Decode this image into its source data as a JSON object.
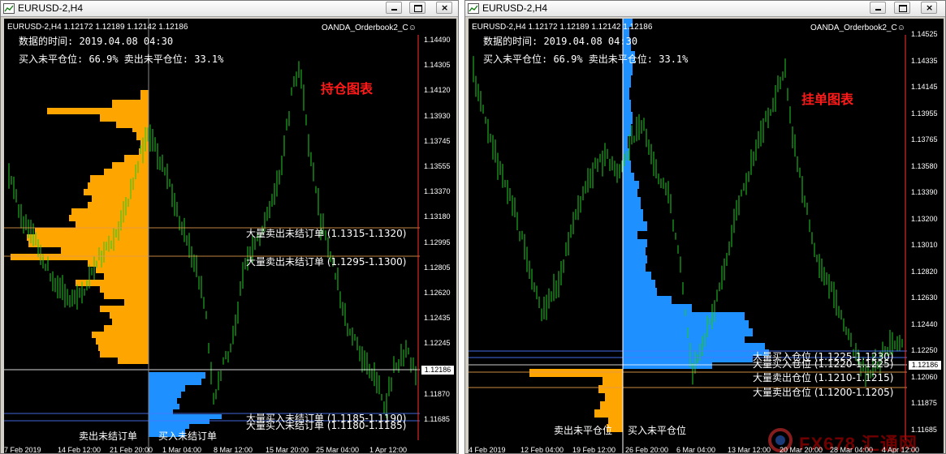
{
  "windows": [
    {
      "title": "EURUSD-2,H4",
      "chart": {
        "symbol_line": "EURUSD-2,H4   1.12172 1.12189 1.12142 1.12186",
        "indicator_name": "OANDA_Orderbook2_C",
        "data_time_label": "数据的时间: 2019.04.08 04:30",
        "ratio_label": "买入未平仓位: 66.9%  卖出未平仓位: 33.1%",
        "chart_name": "持仓图表",
        "annotations": [
          "大量卖出未结订单 (1.1315-1.1320)",
          "大量卖出未结订单 (1.1295-1.1300)",
          "大量买入未结订单 (1.1185-1.1190)",
          "大量买入未结订单 (1.1180-1.1185)"
        ],
        "section_sell": "卖出未结订单",
        "section_buy": "买入未结订单",
        "price_labels": [
          "1.14490",
          "1.14305",
          "1.14120",
          "1.13930",
          "1.13745",
          "1.13555",
          "1.13370",
          "1.13180",
          "1.12995",
          "1.12805",
          "1.12620",
          "1.12435",
          "1.12245",
          "1.12060",
          "1.11870",
          "1.11685"
        ],
        "current_price": "1.12186",
        "time_labels": [
          "7 Feb 2019",
          "14 Feb 12:00",
          "21 Feb 20:00",
          "1 Mar 04:00",
          "8 Mar 12:00",
          "15 Mar 20:00",
          "25 Mar 04:00",
          "1 Apr 12:00"
        ],
        "top_hist_color": "#ffa500",
        "bottom_hist_color": "#1e90ff"
      }
    },
    {
      "title": "EURUSD-2,H4",
      "chart": {
        "symbol_line": "EURUSD-2,H4   1.12172 1.12189 1.12142 1.12186",
        "indicator_name": "OANDA_Orderbook2_C",
        "data_time_label": "数据的时间: 2019.04.08 04:30",
        "ratio_label": "买入未平仓位: 66.9%  卖出未平仓位: 33.1%",
        "chart_name": "挂单图表",
        "annotations": [
          "大量买入仓位 (1.1225-1.1230)",
          "大量买入仓位 (1.1220-1.1225)",
          "大量卖出仓位 (1.1210-1.1215)",
          "大量卖出仓位 (1.1200-1.1205)"
        ],
        "section_sell": "卖出未平仓位",
        "section_buy": "买入未平仓位",
        "price_labels": [
          "1.14525",
          "1.14335",
          "1.14145",
          "1.13955",
          "1.13765",
          "1.13580",
          "1.13390",
          "1.13200",
          "1.13010",
          "1.12820",
          "1.12630",
          "1.12440",
          "1.12250",
          "1.12060",
          "1.11875",
          "1.11685"
        ],
        "current_price": "1.12186",
        "time_labels": [
          "4 Feb 2019",
          "12 Feb 04:00",
          "19 Feb 12:00",
          "26 Feb 20:00",
          "6 Mar 04:00",
          "13 Mar 12:00",
          "20 Mar 20:00",
          "28 Mar 04:00",
          "4 Apr 12:00"
        ],
        "top_hist_color": "#1e90ff",
        "bottom_hist_color": "#ffa500"
      }
    }
  ],
  "watermark": {
    "text": "FX678 汇通网",
    "icon": "fx678-logo-icon"
  },
  "icons": {
    "minimize": "minimize-icon",
    "maximize": "maximize-icon",
    "close": "close-icon",
    "indicator": "smiley-icon"
  }
}
